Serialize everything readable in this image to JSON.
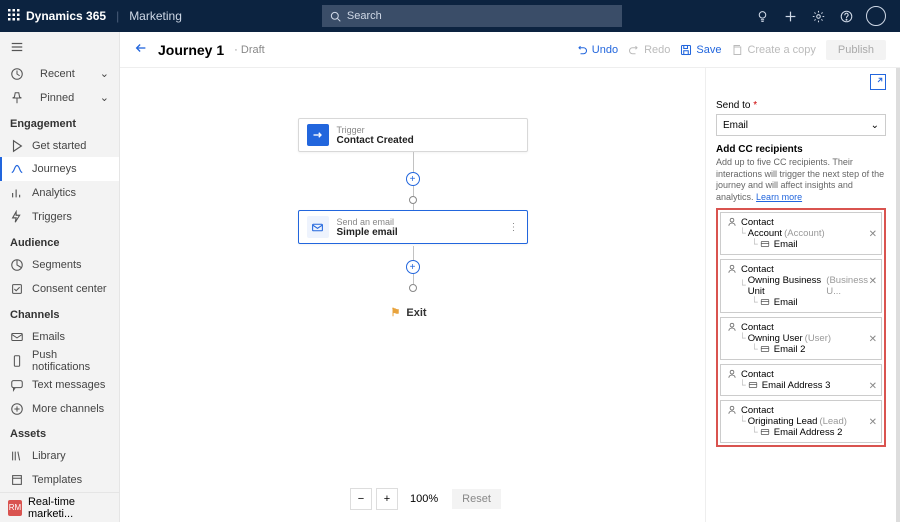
{
  "topbar": {
    "brand": "Dynamics 365",
    "area": "Marketing",
    "search_placeholder": "Search"
  },
  "sidebar": {
    "recent": "Recent",
    "pinned": "Pinned",
    "groups": [
      {
        "title": "Engagement",
        "items": [
          "Get started",
          "Journeys",
          "Analytics",
          "Triggers"
        ],
        "selected": 1
      },
      {
        "title": "Audience",
        "items": [
          "Segments",
          "Consent center"
        ]
      },
      {
        "title": "Channels",
        "items": [
          "Emails",
          "Push notifications",
          "Text messages",
          "More channels"
        ]
      },
      {
        "title": "Assets",
        "items": [
          "Library",
          "Templates"
        ]
      }
    ],
    "footer_badge": "RM",
    "footer_label": "Real-time marketi..."
  },
  "toolbar": {
    "title": "Journey 1",
    "status": "Draft",
    "undo": "Undo",
    "redo": "Redo",
    "save": "Save",
    "copy": "Create a copy",
    "publish": "Publish"
  },
  "canvas": {
    "trigger_label": "Trigger",
    "trigger_value": "Contact Created",
    "email_label": "Send an email",
    "email_value": "Simple email",
    "exit_label": "Exit",
    "zoom": "100%",
    "reset": "Reset"
  },
  "panel": {
    "send_to_label": "Send to",
    "send_to_value": "Email",
    "cc_title": "Add CC recipients",
    "cc_help": "Add up to five CC recipients. Their interactions will trigger the next step of the journey and will affect insights and analytics.",
    "learn_more": "Learn more",
    "cc_items": [
      {
        "top": "Contact",
        "mid": "Account",
        "mid_eg": "(Account)",
        "leaf": "Email"
      },
      {
        "top": "Contact",
        "mid": "Owning Business Unit",
        "mid_eg": "(Business U...",
        "leaf": "Email"
      },
      {
        "top": "Contact",
        "mid": "Owning User",
        "mid_eg": "(User)",
        "leaf": "Email 2"
      },
      {
        "top": "Contact",
        "mid": "",
        "mid_eg": "",
        "leaf": "Email Address 3"
      },
      {
        "top": "Contact",
        "mid": "Originating Lead",
        "mid_eg": "(Lead)",
        "leaf": "Email Address 2"
      }
    ]
  }
}
